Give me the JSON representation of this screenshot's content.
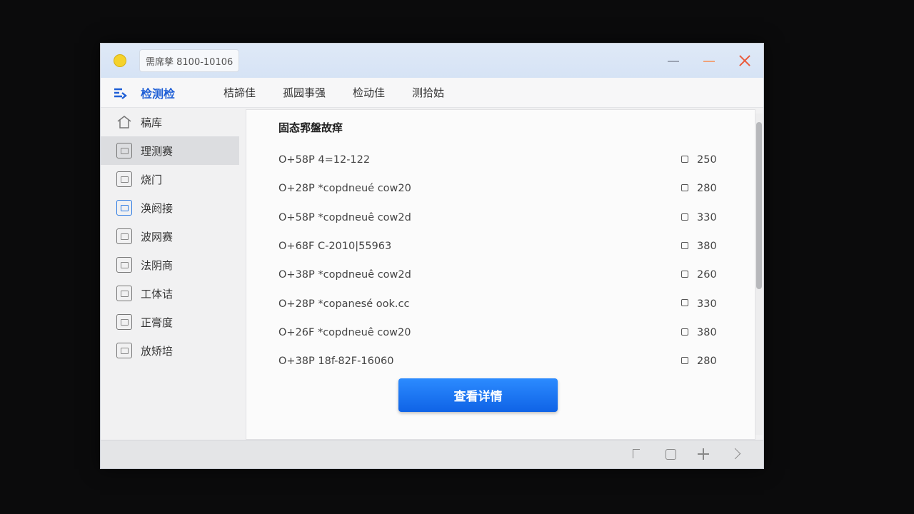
{
  "window": {
    "title": "需席孳 8100-10106",
    "accent": "#1f5fd6"
  },
  "menubar": {
    "brand": "检测检",
    "items": [
      "桔諦佳",
      "孤园事强",
      "检动佳",
      "测拾姑"
    ]
  },
  "sidebar": {
    "items": [
      {
        "label": "稿库",
        "icon": "home-icon"
      },
      {
        "label": "理测赛",
        "icon": "box-icon",
        "active": true
      },
      {
        "label": "烧门",
        "icon": "panel-icon"
      },
      {
        "label": "涣阏接",
        "icon": "refresh-icon"
      },
      {
        "label": "波网赛",
        "icon": "chart-icon"
      },
      {
        "label": "法阴商",
        "icon": "doc-icon"
      },
      {
        "label": "工体诘",
        "icon": "window-icon"
      },
      {
        "label": "正膏度",
        "icon": "frame-icon"
      },
      {
        "label": "放矫培",
        "icon": "upload-icon"
      }
    ]
  },
  "content": {
    "title": "固态郛盤故痒",
    "rows": [
      {
        "label": "O+58P 4=12-122",
        "value": "250"
      },
      {
        "label": "O+28P *copdneué cow20",
        "value": "280"
      },
      {
        "label": "O+58P *copdneuê cow2d",
        "value": "330"
      },
      {
        "label": "O+68F C-2010|55963",
        "value": "380"
      },
      {
        "label": "O+38P *copdneuê cow2d",
        "value": "260"
      },
      {
        "label": "O+28P *copanesé ook.cc",
        "value": "330"
      },
      {
        "label": "O+26F *copdneuê cow20",
        "value": "380"
      },
      {
        "label": "O+38P 18f-82F-16060",
        "value": "280"
      }
    ],
    "button_label": "查看详情"
  }
}
